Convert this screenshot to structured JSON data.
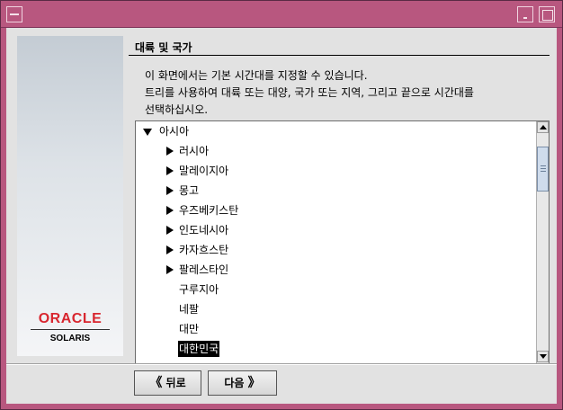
{
  "section": {
    "heading": "대륙 및 국가",
    "description_line1": "이 화면에서는 기본 시간대를 지정할 수 있습니다.",
    "description_line2": "트리를 사용하여 대륙 또는 대양, 국가 또는 지역, 그리고 끝으로 시간대를",
    "description_line3": "선택하십시오."
  },
  "logo": {
    "brand": "ORACLE",
    "product": "SOLARIS"
  },
  "tree": {
    "root": "아시아",
    "items": [
      {
        "label": "러시아",
        "expandable": true
      },
      {
        "label": "말레이지아",
        "expandable": true
      },
      {
        "label": "몽고",
        "expandable": true
      },
      {
        "label": "우즈베키스탄",
        "expandable": true
      },
      {
        "label": "인도네시아",
        "expandable": true
      },
      {
        "label": "카자흐스탄",
        "expandable": true
      },
      {
        "label": "팔레스타인",
        "expandable": true
      },
      {
        "label": "구루지아",
        "expandable": false
      },
      {
        "label": "네팔",
        "expandable": false
      },
      {
        "label": "대만",
        "expandable": false
      },
      {
        "label": "대한민국",
        "expandable": false,
        "selected": true
      }
    ]
  },
  "buttons": {
    "back": "뒤로",
    "next": "다음",
    "back_chevron": "《",
    "next_chevron": "》"
  },
  "colors": {
    "titlebar": "#b8577f",
    "selection": "#000000",
    "oracle_red": "#d8262f"
  }
}
